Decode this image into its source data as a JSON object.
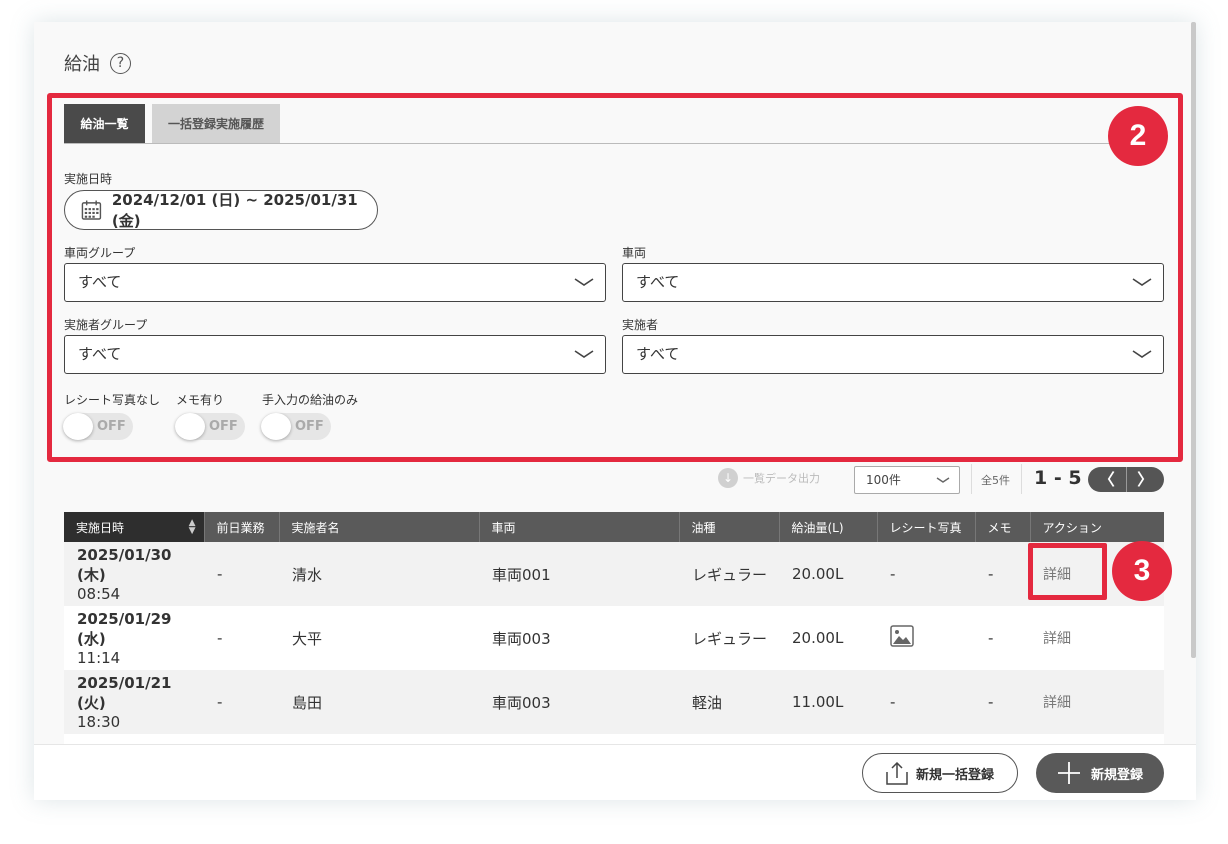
{
  "page": {
    "title": "給油"
  },
  "tabs": [
    {
      "label": "給油一覧"
    },
    {
      "label": "一括登録実施履歴"
    }
  ],
  "filters": {
    "date_label": "実施日時",
    "date_range": "2024/12/01 (日) ~ 2025/01/31 (金)",
    "vehicle_group_label": "車両グループ",
    "vehicle_group_value": "すべて",
    "vehicle_label": "車両",
    "vehicle_value": "すべて",
    "operator_group_label": "実施者グループ",
    "operator_group_value": "すべて",
    "operator_label": "実施者",
    "operator_value": "すべて"
  },
  "toggles": [
    {
      "label": "レシート写真なし",
      "state": "OFF"
    },
    {
      "label": "メモ有り",
      "state": "OFF"
    },
    {
      "label": "手入力の給油のみ",
      "state": "OFF"
    }
  ],
  "toolbar": {
    "export_label": "一覧データ出力",
    "per_page": "100件",
    "total": "全5件",
    "range": "1 - 5",
    "prev": "〈",
    "next": "〉"
  },
  "table": {
    "columns": [
      "実施日時",
      "前日業務",
      "実施者名",
      "車両",
      "油種",
      "給油量(L)",
      "レシート写真",
      "メモ",
      "アクション"
    ],
    "rows": [
      {
        "date": "2025/01/30 (木)",
        "time": "08:54",
        "prev": "-",
        "name": "清水",
        "vehicle": "車両001",
        "fuel": "レギュラー",
        "amount": "20.00L",
        "receipt": "-",
        "memo": "-",
        "action": "詳細"
      },
      {
        "date": "2025/01/29 (水)",
        "time": "11:14",
        "prev": "-",
        "name": "大平",
        "vehicle": "車両003",
        "fuel": "レギュラー",
        "amount": "20.00L",
        "receipt": "image-icon",
        "memo": "-",
        "action": "詳細"
      },
      {
        "date": "2025/01/21 (火)",
        "time": "18:30",
        "prev": "-",
        "name": "島田",
        "vehicle": "車両003",
        "fuel": "軽油",
        "amount": "11.00L",
        "receipt": "-",
        "memo": "-",
        "action": "詳細"
      }
    ]
  },
  "footer": {
    "bulk_register": "新規一括登録",
    "new_register": "新規登録"
  },
  "annotations": {
    "badge_2": "2",
    "badge_3": "3"
  },
  "colors": {
    "highlight": "#e4293f",
    "header": "#5a5a5a",
    "active_tab": "#4a4a4a"
  }
}
